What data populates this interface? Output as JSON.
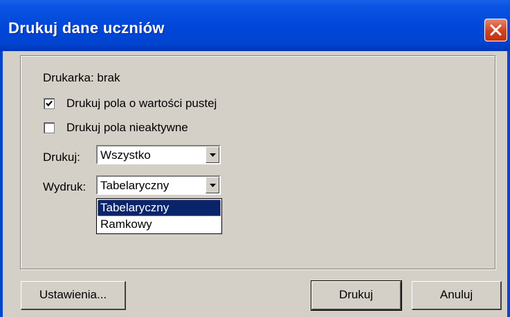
{
  "window": {
    "title": "Drukuj dane uczniów"
  },
  "printer": {
    "label": "Drukarka: brak"
  },
  "options": {
    "print_empty": {
      "label": "Drukuj pola o wartości pustej",
      "checked": true
    },
    "print_inactive": {
      "label": "Drukuj pola nieaktywne",
      "checked": false
    }
  },
  "print_select": {
    "label": "Drukuj:",
    "value": "Wszystko"
  },
  "layout_select": {
    "label": "Wydruk:",
    "value": "Tabelaryczny",
    "options": [
      "Tabelaryczny",
      "Ramkowy"
    ],
    "highlighted": "Tabelaryczny"
  },
  "buttons": {
    "settings": "Ustawienia...",
    "print": "Drukuj",
    "cancel": "Anuluj"
  },
  "colors": {
    "titlebar": "#0046d8",
    "face": "#d4d0c8",
    "highlight": "#0a246a",
    "close": "#d0421f"
  }
}
